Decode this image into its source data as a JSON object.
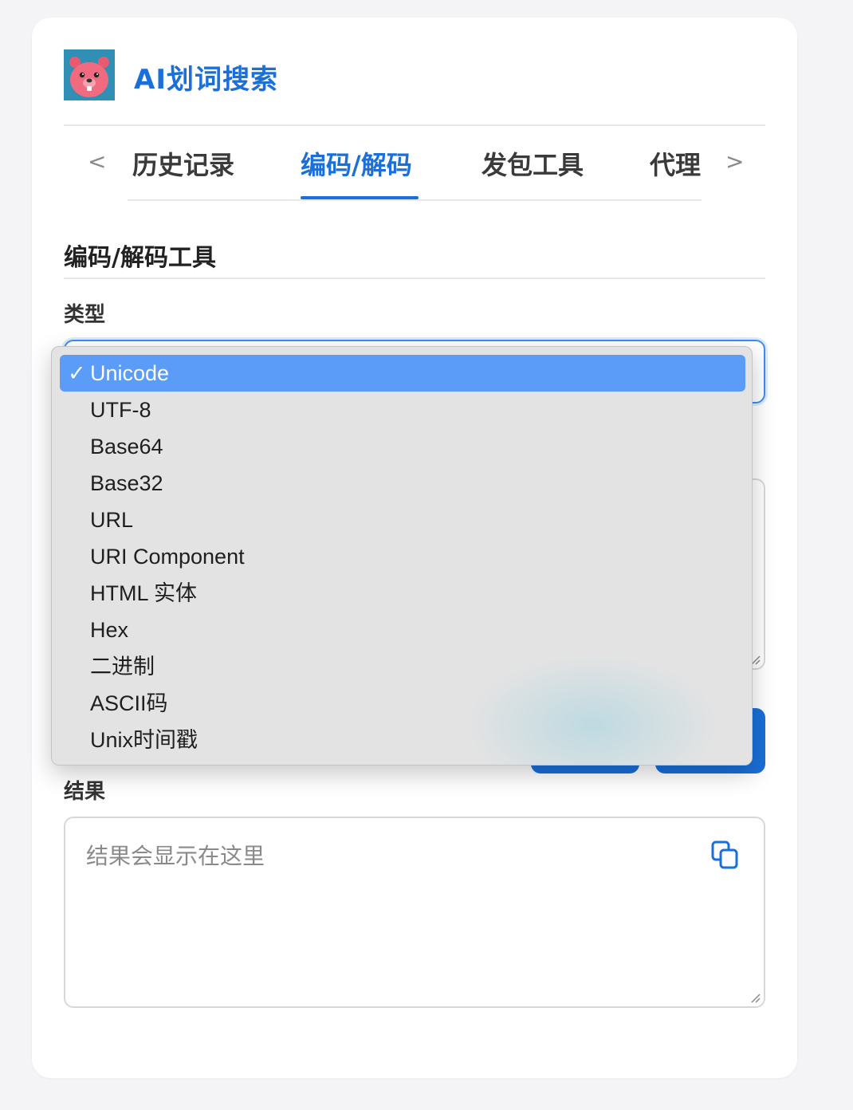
{
  "app": {
    "title": "AI划词搜索",
    "logo": "beaver-avatar"
  },
  "tabs": {
    "prev": "<",
    "next": ">",
    "items": [
      {
        "label": "历史记录"
      },
      {
        "label": "编码/解码"
      },
      {
        "label": "发包工具"
      },
      {
        "label": "代理"
      }
    ],
    "active_index": 1
  },
  "section": {
    "title": "编码/解码工具"
  },
  "type_field": {
    "label": "类型",
    "selected": "Unicode"
  },
  "dropdown": {
    "check_mark": "✓",
    "options": [
      "Unicode",
      "UTF-8",
      "Base64",
      "Base32",
      "URL",
      "URI Component",
      "HTML 实体",
      "Hex",
      "二进制",
      "ASCII码",
      "Unix时间戳"
    ]
  },
  "result": {
    "label": "结果",
    "placeholder": "结果会显示在这里"
  },
  "colors": {
    "accent": "#1a6fd9",
    "selected_option": "#5a9cf8",
    "dropdown_bg": "#e3e3e3"
  }
}
